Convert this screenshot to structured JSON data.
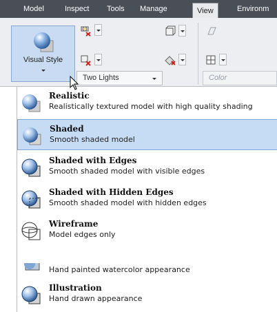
{
  "tabs": [
    {
      "label": "Model"
    },
    {
      "label": "Inspect"
    },
    {
      "label": "Tools"
    },
    {
      "label": "Manage"
    },
    {
      "label": "View",
      "active": true
    },
    {
      "label": "Environm"
    }
  ],
  "ribbon": {
    "visual_style_button": {
      "label": "Visual Style"
    },
    "lights_dropdown": {
      "value": "Two Lights"
    },
    "color_field": {
      "placeholder": "Color"
    }
  },
  "menu": {
    "items": [
      {
        "title": "Realistic",
        "description": "Realistically textured model with high quality shading",
        "icon": "sphere-realistic-icon"
      },
      {
        "title": "Shaded",
        "description": "Smooth shaded model",
        "icon": "sphere-shaded-icon",
        "selected": true
      },
      {
        "title": "Shaded with Edges",
        "description": "Smooth shaded model with visible edges",
        "icon": "sphere-edges-icon"
      },
      {
        "title": "Shaded with Hidden Edges",
        "description": "Smooth shaded model with hidden edges",
        "icon": "sphere-hidden-edges-icon"
      },
      {
        "title": "Wireframe",
        "description": "Model edges only",
        "icon": "wireframe-icon"
      },
      {
        "title": "",
        "description": "Hand painted watercolor appearance",
        "icon": "watercolor-icon"
      },
      {
        "title": "Illustration",
        "description": "Hand drawn appearance",
        "icon": "sphere-illustration-icon"
      }
    ]
  },
  "colors": {
    "tabbar_bg": "#4a4e55",
    "ribbon_bg": "#eceef1",
    "selected_bg": "#c5dcf4",
    "selected_border": "#7fa7d8"
  }
}
